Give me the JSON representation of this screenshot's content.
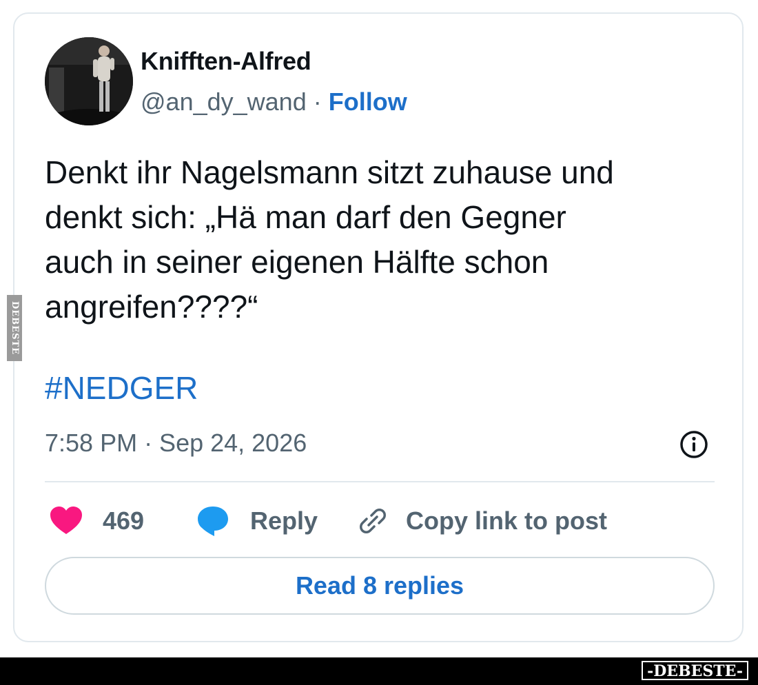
{
  "author": {
    "display_name": "Knifften-Alfred",
    "handle": "@an_dy_wand",
    "separator": " · ",
    "follow_label": "Follow"
  },
  "tweet": {
    "text_lines": [
      "Denkt ihr Nagelsmann sitzt zuhause und",
      "denkt sich: „Hä man darf den Gegner",
      "auch in seiner eigenen Hälfte schon",
      "angreifen????“"
    ],
    "hashtag": "#NEDGER",
    "timestamp": "7:58 PM · Sep 24, 2026"
  },
  "actions": {
    "like_count": "469",
    "reply_label": "Reply",
    "copy_link_label": "Copy link to post"
  },
  "read_replies_label": "Read 8 replies",
  "watermark": {
    "side_text": "DEBESTE",
    "bottom_text": "-DEBESTE-"
  },
  "colors": {
    "link_blue": "#1d6fc9",
    "like_pink": "#f91880",
    "reply_blue": "#1d9bf0",
    "muted_gray": "#536471",
    "text_dark": "#0f1419",
    "border_gray": "#e1e8ed"
  },
  "icons": {
    "info": "info-circle-icon",
    "like": "heart-icon",
    "reply": "speech-bubble-icon",
    "copy": "link-icon"
  }
}
